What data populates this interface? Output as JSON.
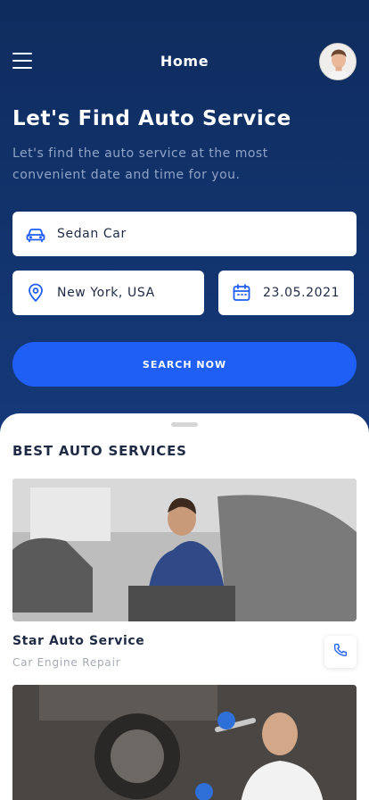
{
  "header": {
    "title": "Home"
  },
  "hero": {
    "headline": "Let's Find Auto Service",
    "subline": "Let's find the auto service at the most convenient date and time for you."
  },
  "search": {
    "vehicle": "Sedan Car",
    "location": "New York, USA",
    "date": "23.05.2021",
    "button_label": "SEARCH NOW"
  },
  "section": {
    "title": "BEST AUTO SERVICES"
  },
  "services": [
    {
      "name": "Star Auto Service",
      "category": "Car Engine Repair"
    }
  ],
  "colors": {
    "hero_bg": "#12336a",
    "accent": "#1f5ff5",
    "text_dark": "#1f2a44",
    "text_muted": "#a6aab3"
  },
  "icons": [
    "menu-icon",
    "car-icon",
    "location-pin-icon",
    "calendar-icon",
    "phone-icon"
  ]
}
